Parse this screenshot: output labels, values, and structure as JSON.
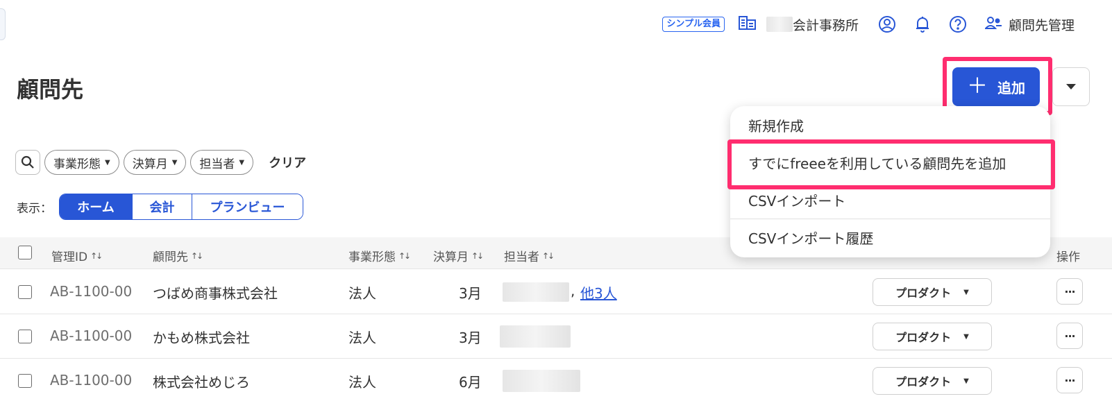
{
  "header": {
    "plan_badge": "シンプル会員",
    "office_name": "会計事務所",
    "client_management": "顧問先管理"
  },
  "page": {
    "title": "顧問先"
  },
  "add_button": {
    "plus": "＋",
    "label": "追加"
  },
  "add_menu": {
    "items": [
      "新規作成",
      "すでにfreeeを利用している顧問先を追加",
      "CSVインポート",
      "CSVインポート履歴"
    ]
  },
  "filters": {
    "chips": [
      "事業形態",
      "決算月",
      "担当者"
    ],
    "clear": "クリア"
  },
  "view": {
    "label": "表示：",
    "options": [
      "ホーム",
      "会計",
      "プランビュー"
    ],
    "selected": "ホーム"
  },
  "table": {
    "columns": {
      "id": "管理ID",
      "client": "顧問先",
      "business_type": "事業形態",
      "closing_month": "決算月",
      "staff": "担当者",
      "operations": "操作"
    },
    "rows": [
      {
        "id": "AB-1100-00",
        "client": "つばめ商事株式会社",
        "business_type": "法人",
        "closing_month": "3月",
        "staff_more": "他3人",
        "product": "プロダクト"
      },
      {
        "id": "AB-1100-00",
        "client": "かもめ株式会社",
        "business_type": "法人",
        "closing_month": "3月",
        "staff_more": "",
        "product": "プロダクト"
      },
      {
        "id": "AB-1100-00",
        "client": "株式会社めじろ",
        "business_type": "法人",
        "closing_month": "6月",
        "staff_more": "",
        "product": "プロダクト"
      }
    ],
    "more_label": "···"
  },
  "colors": {
    "primary": "#2856d6",
    "highlight": "#ff2d6f",
    "badge": "#2864f0"
  }
}
